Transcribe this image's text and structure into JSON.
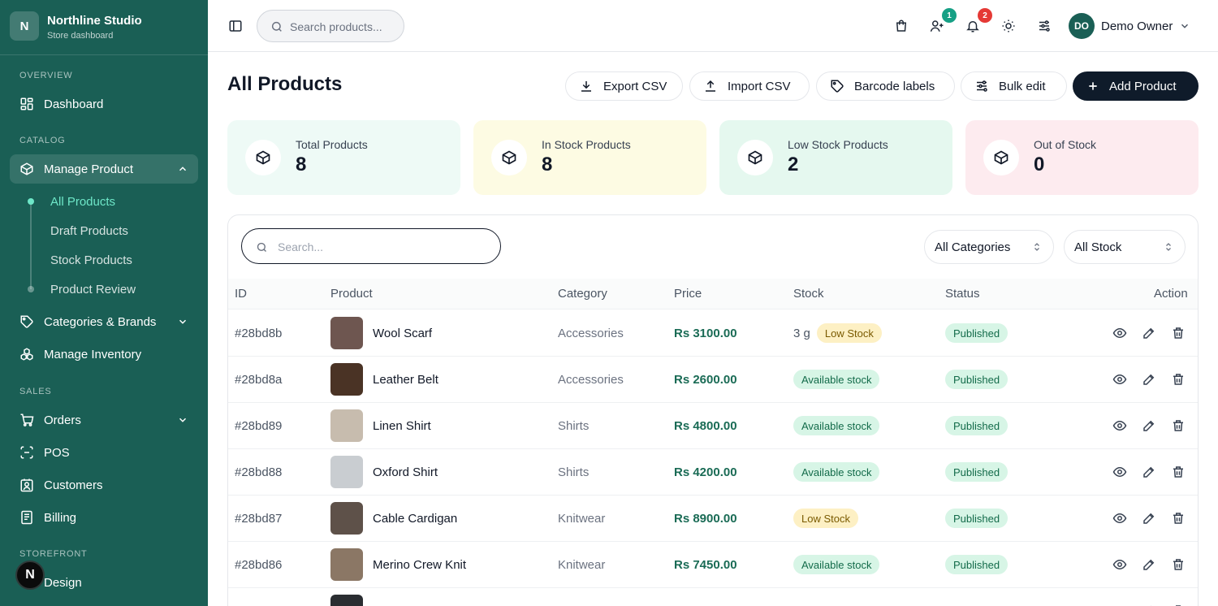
{
  "brand": {
    "logo": "N",
    "name": "Northline Studio",
    "subtitle": "Store dashboard"
  },
  "sidebar": {
    "overview_label": "OVERVIEW",
    "catalog_label": "CATALOG",
    "sales_label": "SALES",
    "storefront_label": "STOREFRONT",
    "dashboard": "Dashboard",
    "manage_product": "Manage Product",
    "sub_items": [
      "All Products",
      "Draft Products",
      "Stock Products",
      "Product Review"
    ],
    "categories_brands": "Categories & Brands",
    "manage_inventory": "Manage Inventory",
    "orders": "Orders",
    "pos": "POS",
    "customers": "Customers",
    "billing": "Billing",
    "design": "Design",
    "floating_badge": "N"
  },
  "topbar": {
    "search_placeholder": "Search products...",
    "users_badge": "1",
    "notifications_badge": "2",
    "user_initials": "DO",
    "user_name": "Demo Owner"
  },
  "page": {
    "title": "All Products",
    "actions": {
      "export": "Export CSV",
      "import": "Import CSV",
      "barcode": "Barcode labels",
      "bulk": "Bulk edit",
      "add": "Add Product"
    }
  },
  "stats": [
    {
      "label": "Total Products",
      "value": "8"
    },
    {
      "label": "In Stock Products",
      "value": "8"
    },
    {
      "label": "Low Stock Products",
      "value": "2"
    },
    {
      "label": "Out of Stock",
      "value": "0"
    }
  ],
  "table": {
    "search_placeholder": "Search...",
    "category_filter": "All Categories",
    "stock_filter": "All Stock",
    "headers": {
      "id": "ID",
      "product": "Product",
      "category": "Category",
      "price": "Price",
      "stock": "Stock",
      "status": "Status",
      "action": "Action"
    },
    "rows": [
      {
        "id": "#28bd8b",
        "name": "Wool Scarf",
        "category": "Accessories",
        "price": "Rs 3100.00",
        "qty": "3 g",
        "stock": "Low Stock",
        "stock_type": "low",
        "status": "Published",
        "thumb": "#6e5650"
      },
      {
        "id": "#28bd8a",
        "name": "Leather Belt",
        "category": "Accessories",
        "price": "Rs 2600.00",
        "qty": "",
        "stock": "Available stock",
        "stock_type": "avail",
        "status": "Published",
        "thumb": "#4a3325"
      },
      {
        "id": "#28bd89",
        "name": "Linen Shirt",
        "category": "Shirts",
        "price": "Rs 4800.00",
        "qty": "",
        "stock": "Available stock",
        "stock_type": "avail",
        "status": "Published",
        "thumb": "#c7bcae"
      },
      {
        "id": "#28bd88",
        "name": "Oxford Shirt",
        "category": "Shirts",
        "price": "Rs 4200.00",
        "qty": "",
        "stock": "Available stock",
        "stock_type": "avail",
        "status": "Published",
        "thumb": "#c9cdd1"
      },
      {
        "id": "#28bd87",
        "name": "Cable Cardigan",
        "category": "Knitwear",
        "price": "Rs 8900.00",
        "qty": "",
        "stock": "Low Stock",
        "stock_type": "low",
        "status": "Published",
        "thumb": "#5e5149"
      },
      {
        "id": "#28bd86",
        "name": "Merino Crew Knit",
        "category": "Knitwear",
        "price": "Rs 7450.00",
        "qty": "",
        "stock": "Available stock",
        "stock_type": "avail",
        "status": "Published",
        "thumb": "#8b7765"
      },
      {
        "id": "",
        "name": "",
        "category": "",
        "price": "",
        "qty": "",
        "stock": "",
        "stock_type": "avail",
        "status": "",
        "thumb": "#2a2d31"
      }
    ]
  },
  "colors": {
    "sidebar_bg": "#1a5f55",
    "accent": "#6ee7c8",
    "primary_button": "#0f1b2a",
    "stat_total": "#eefaf6",
    "stat_in_stock": "#fdfbe3",
    "stat_low": "#e5f8ef",
    "stat_out": "#fdebef"
  }
}
